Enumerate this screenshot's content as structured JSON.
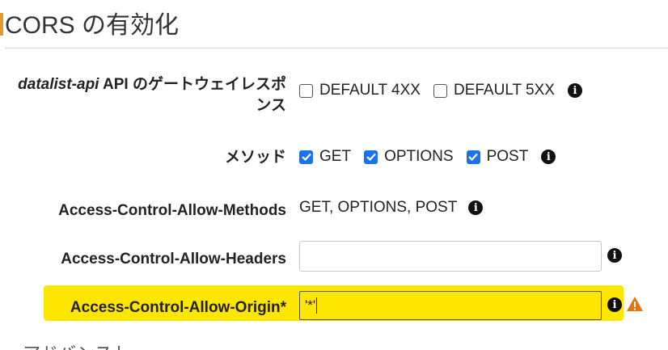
{
  "title": "CORS の有効化",
  "gateway_responses": {
    "label_api": "datalist-api",
    "label_rest": " API のゲートウェイレスポンス",
    "options": [
      {
        "label": "DEFAULT 4XX",
        "checked": false
      },
      {
        "label": "DEFAULT 5XX",
        "checked": false
      }
    ]
  },
  "methods": {
    "label": "メソッド",
    "options": [
      {
        "label": "GET",
        "checked": true
      },
      {
        "label": "OPTIONS",
        "checked": true
      },
      {
        "label": "POST",
        "checked": true
      }
    ]
  },
  "allow_methods": {
    "label": "Access-Control-Allow-Methods",
    "value": "GET, OPTIONS, POST"
  },
  "allow_headers": {
    "label": "Access-Control-Allow-Headers",
    "value": ""
  },
  "allow_origin": {
    "label": "Access-Control-Allow-Origin*",
    "value": "'*'"
  },
  "bottom_text": "ー アドバンスト",
  "info_icon": "i",
  "colors": {
    "highlight": "#ffe600",
    "checkbox_accent": "#1a73e8",
    "warning": "#e8730c"
  }
}
